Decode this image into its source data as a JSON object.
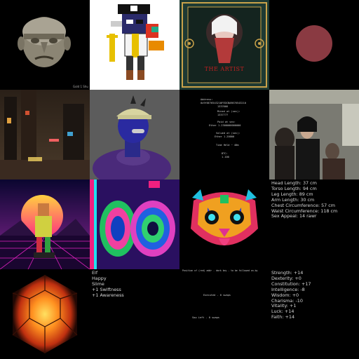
{
  "tiles": {
    "stone_head": {
      "caption": "Gold 1 Shu"
    },
    "poster": {
      "title": "THE ARTIST"
    },
    "readout": {
      "lines": [
        "Address:",
        "0x9f8E76543210FEDCBA9876543210",
        "1337666",
        "Mined at (sec):",
        "1337777",
        "Paid at sec:",
        "Ether 1.2300000000000",
        "Valued at (sec):",
        "Ether 1.20000",
        "Time Held ~ 40m",
        "BTC:",
        "1.100"
      ]
    },
    "body_stats": {
      "lines": [
        "Head Length: 37 cm",
        "Torso Length: 94 cm",
        "Leg Length: 89 cm",
        "Arm Length: 30 cm",
        "Chest Circumference: 57 cm",
        "Waist Circumference: 118 cm",
        "Sex Appeal: 14 rawr"
      ]
    },
    "elf_stats": {
      "lines": [
        "Elf",
        "Happy",
        "Slime",
        "+1 Swiftness",
        "+1 Awareness"
      ]
    },
    "dark_text": {
      "line1": "Position of (red) addr - dark key - to be followed on-by",
      "line2": "Executed - 0 swaps",
      "line3": "Sow Left - 0 swaps"
    },
    "attributes": {
      "lines": [
        "Strength: +14",
        "Dexterity: +0",
        "Constitution: +17",
        "Intelligence: -8",
        "Wisdom: +0",
        "Charisma: -10",
        "Vitality: +1",
        "Luck: +14",
        "Faith: +14"
      ]
    }
  },
  "colors": {
    "background": "#000000",
    "text": "#d8d8d8",
    "circle": "#8a3a42",
    "poster_gold": "#c9a24a",
    "poster_red": "#c02020"
  },
  "icons": [
    "stone-head",
    "pixel-pirate",
    "art-deco-poster",
    "red-circle",
    "rainy-city",
    "blue-figure",
    "subway-crowd",
    "synthwave-robot",
    "psychedelic-rings",
    "neon-tiger",
    "molten-orb"
  ]
}
